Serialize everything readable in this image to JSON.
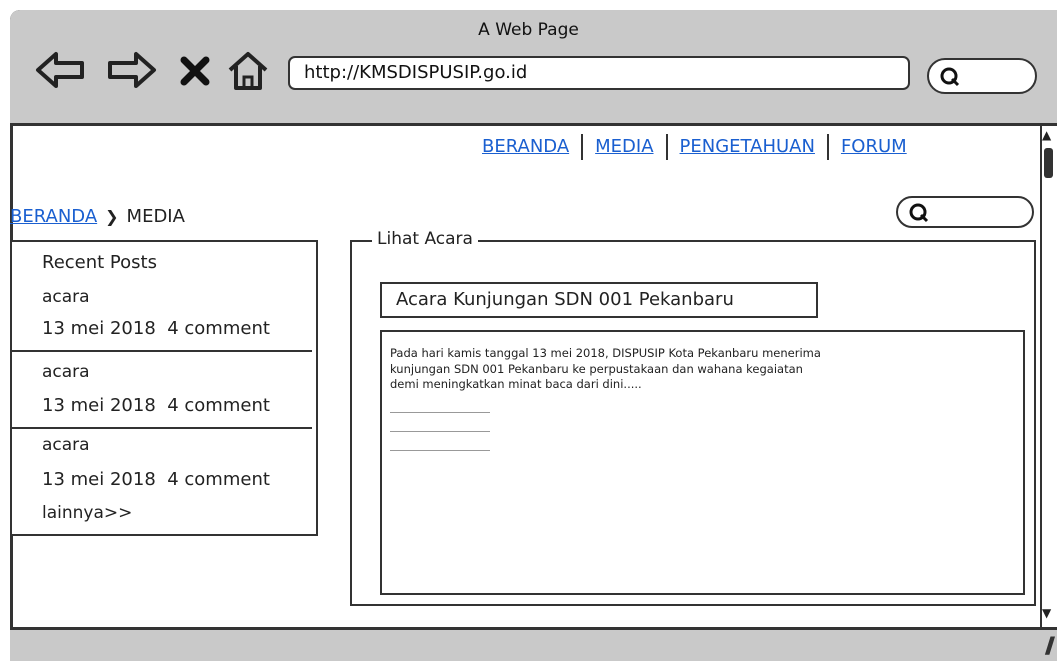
{
  "window": {
    "title": "A Web Page",
    "url": "http://KMSDISPUSIP.go.id"
  },
  "toolbar": {
    "icons": [
      "back-arrow-icon",
      "forward-arrow-icon",
      "close-icon",
      "home-icon"
    ]
  },
  "nav": {
    "items": [
      {
        "label": "BERANDA"
      },
      {
        "label": "MEDIA"
      },
      {
        "label": "PENGETAHUAN"
      },
      {
        "label": "FORUM"
      }
    ]
  },
  "breadcrumb": {
    "home": "BERANDA",
    "current": "MEDIA"
  },
  "sidebar": {
    "title": "Recent Posts",
    "posts": [
      {
        "title": "acara",
        "date": "13 mei 2018",
        "comments": "4 comment"
      },
      {
        "title": "acara",
        "date": "13 mei 2018",
        "comments": "4 comment"
      },
      {
        "title": "acara",
        "date": "13 mei 2018",
        "comments": "4 comment"
      }
    ],
    "more": "lainnya>>"
  },
  "content": {
    "section_label": "Lihat Acara",
    "event_title": "Acara Kunjungan SDN 001 Pekanbaru",
    "event_body": "Pada hari kamis tanggal 13 mei 2018, DISPUSIP Kota Pekanbaru menerima\nkunjungan SDN 001 Pekanbaru ke perpustakaan dan wahana kegaiatan\ndemi meningkatkan minat baca dari dini....."
  },
  "colors": {
    "link": "#1a5fd0",
    "chrome": "#c9c9c9",
    "stroke": "#333333"
  }
}
